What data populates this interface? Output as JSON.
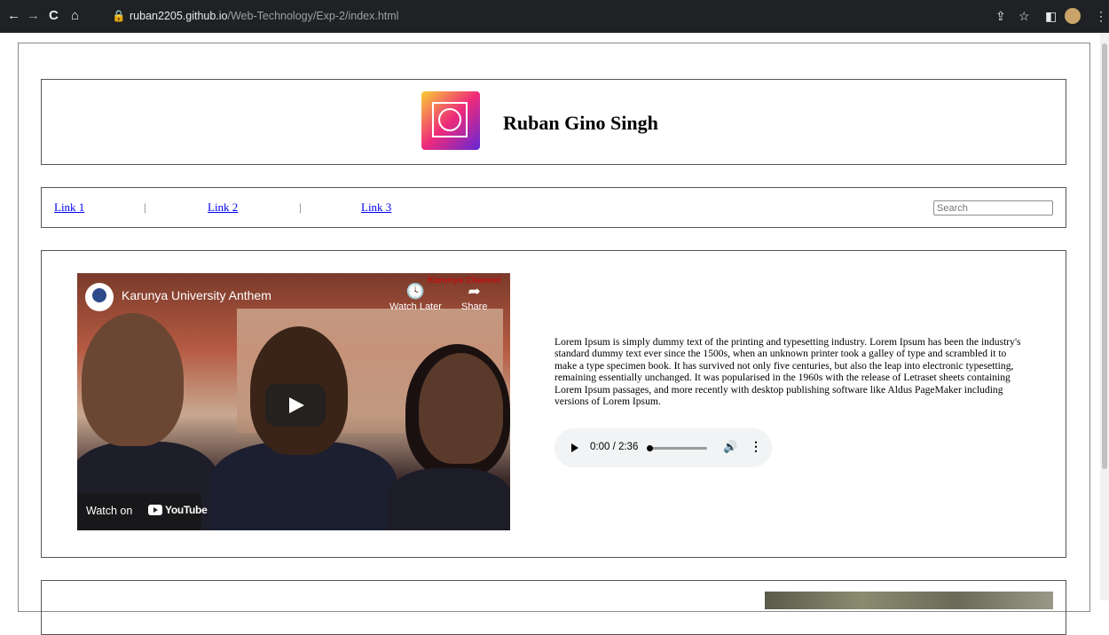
{
  "browser": {
    "back_glyph": "←",
    "forward_glyph": "→",
    "reload_glyph": "C",
    "home_glyph": "⌂",
    "url_host": "ruban2205.github.io",
    "url_path": "/Web-Technology/Exp-2/index.html",
    "share_glyph": "⇪",
    "star_glyph": "☆",
    "tab_glyph": "◧",
    "menu_glyph": "⋮"
  },
  "header": {
    "logo_icon": "smiley-frame-icon",
    "title": "Ruban Gino Singh"
  },
  "nav": {
    "links": [
      "Link 1",
      "Link 2",
      "Link 3"
    ],
    "separator": "|",
    "search_placeholder": "Search"
  },
  "video": {
    "title": "Karunya University Anthem",
    "watch_later_label": "Watch Later",
    "share_label": "Share",
    "brand_overlay": "Karunya Channel",
    "watch_on_label": "Watch on",
    "youtube_label": "YouTube"
  },
  "article": {
    "paragraph": "Lorem Ipsum is simply dummy text of the printing and typesetting industry. Lorem Ipsum has been the industry's standard dummy text ever since the 1500s, when an unknown printer took a galley of type and scrambled it to make a type specimen book. It has survived not only five centuries, but also the leap into electronic typesetting, remaining essentially unchanged. It was popularised in the 1960s with the release of Letraset sheets containing Lorem Ipsum passages, and more recently with desktop publishing software like Aldus PageMaker including versions of Lorem Ipsum."
  },
  "audio": {
    "time": "0:00 / 2:36",
    "progress_fraction": 0
  },
  "colors": {
    "link": "#0000ee",
    "chrome_bg": "#202124"
  }
}
